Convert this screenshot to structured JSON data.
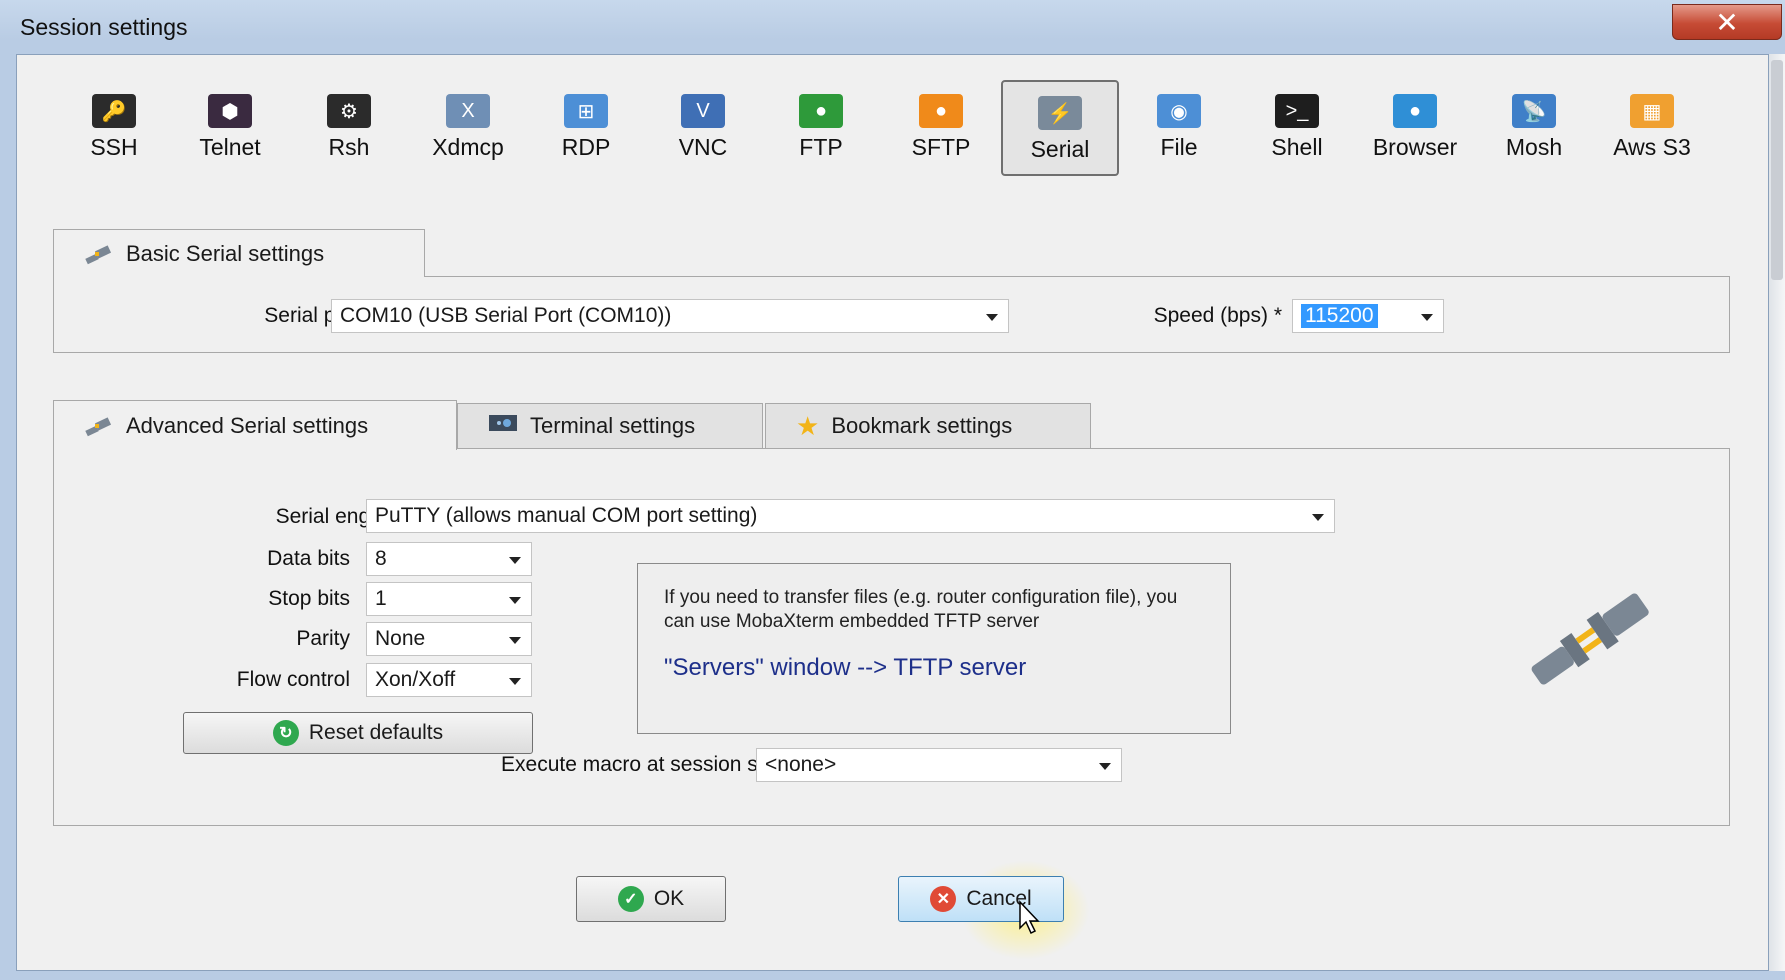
{
  "window": {
    "title": "Session settings",
    "close_glyph": "✕"
  },
  "session_types": [
    {
      "label": "SSH",
      "icon": "key-icon",
      "color": "#2b2b2b",
      "glyph": "🔑"
    },
    {
      "label": "Telnet",
      "icon": "telnet-icon",
      "color": "#3a2a40",
      "glyph": "⬢"
    },
    {
      "label": "Rsh",
      "icon": "rsh-icon",
      "color": "#2b2b2b",
      "glyph": "⚙"
    },
    {
      "label": "Xdmcp",
      "icon": "xdmcp-icon",
      "color": "#6f8fb5",
      "glyph": "X"
    },
    {
      "label": "RDP",
      "icon": "rdp-icon",
      "color": "#4d8fd6",
      "glyph": "⊞"
    },
    {
      "label": "VNC",
      "icon": "vnc-icon",
      "color": "#3f6fb5",
      "glyph": "V"
    },
    {
      "label": "FTP",
      "icon": "ftp-globe-icon",
      "color": "#2e9a3a",
      "glyph": "●"
    },
    {
      "label": "SFTP",
      "icon": "sftp-globe-icon",
      "color": "#f08a1a",
      "glyph": "●"
    },
    {
      "label": "Serial",
      "icon": "serial-plug-icon",
      "color": "#7a8a9a",
      "glyph": "⚡"
    },
    {
      "label": "File",
      "icon": "file-monitor-icon",
      "color": "#4d8fd6",
      "glyph": "◉"
    },
    {
      "label": "Shell",
      "icon": "shell-terminal-icon",
      "color": "#1e1e1e",
      "glyph": ">_"
    },
    {
      "label": "Browser",
      "icon": "browser-globe-icon",
      "color": "#2f8fd6",
      "glyph": "●"
    },
    {
      "label": "Mosh",
      "icon": "mosh-satellite-icon",
      "color": "#3f7fc8",
      "glyph": "📡"
    },
    {
      "label": "Aws S3",
      "icon": "aws-s3-icon",
      "color": "#f0a030",
      "glyph": "▦"
    }
  ],
  "active_session_type": "Serial",
  "basic_tab": {
    "label": "Basic Serial settings",
    "serial_port_label": "Serial port *",
    "serial_port_value": "COM10  (USB Serial Port (COM10))",
    "speed_label": "Speed (bps) *",
    "speed_value": "115200"
  },
  "advanced_tabs": [
    {
      "label": "Advanced Serial settings",
      "icon": "plug-icon"
    },
    {
      "label": "Terminal settings",
      "icon": "terminal-settings-icon"
    },
    {
      "label": "Bookmark settings",
      "icon": "star-icon"
    }
  ],
  "advanced": {
    "serial_engine_label": "Serial engine:",
    "serial_engine_value": "PuTTY   (allows manual COM port setting)",
    "data_bits_label": "Data bits",
    "data_bits_value": "8",
    "stop_bits_label": "Stop bits",
    "stop_bits_value": "1",
    "parity_label": "Parity",
    "parity_value": "None",
    "flow_control_label": "Flow control",
    "flow_control_value": "Xon/Xoff",
    "reset_label": "Reset defaults",
    "macro_label": "Execute macro at session start:",
    "macro_value": "<none>"
  },
  "info": {
    "text": "If you need to transfer files (e.g. router configuration file), you can use MobaXterm embedded TFTP server",
    "link": "\"Servers\" window  -->  TFTP server"
  },
  "buttons": {
    "ok": "OK",
    "cancel": "Cancel"
  },
  "colors": {
    "ok_green": "#2fa84f",
    "cancel_red": "#e04a36",
    "link_blue": "#1d2f8a",
    "selection_blue": "#3399ff"
  }
}
